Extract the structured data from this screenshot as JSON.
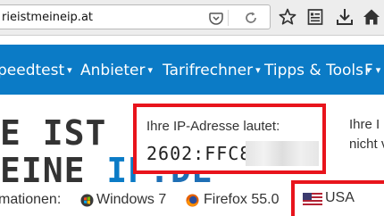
{
  "browser": {
    "url": "rieistmeineip.at"
  },
  "nav": {
    "items": [
      {
        "label": "peedtest"
      },
      {
        "label": "Anbieter"
      },
      {
        "label": "Tarifrechner"
      },
      {
        "label": "Tipps & Tools"
      },
      {
        "label": "F"
      }
    ],
    "caret": "▾"
  },
  "logo": {
    "line1": "E IST",
    "line2_prefix": "EINE ",
    "line2_ip": "IP",
    "line2_suffix": ".DE"
  },
  "ip_box": {
    "label": "Ihre IP-Adresse lautet:",
    "value": "2602:FFC8:"
  },
  "right_column": {
    "line1": "Ihre I",
    "line2": "nicht v"
  },
  "info": {
    "label": "mationen:",
    "os": "Windows 7",
    "browser": "Firefox 55.0",
    "country": "USA"
  },
  "colors": {
    "nav_bg": "#0b7bc6",
    "highlight_border": "#e8141c"
  }
}
